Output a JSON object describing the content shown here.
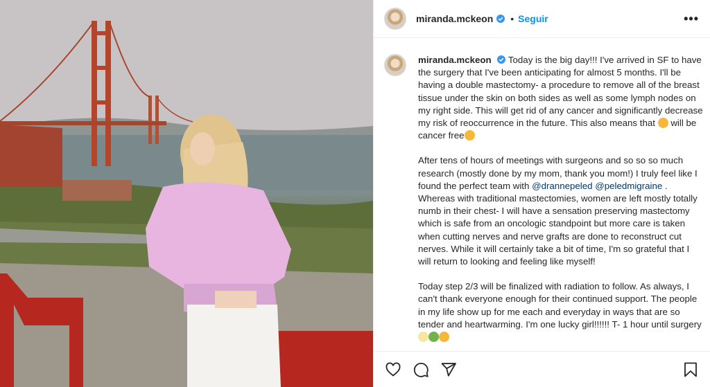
{
  "post": {
    "username": "miranda.mckeon",
    "follow_label": "Seguir",
    "dot": "•",
    "more": "•••",
    "caption": {
      "p1_a": "Today is the big day!!! I've arrived in SF to have the surgery that I've been anticipating for almost 5 months. I'll be having a double mastectomy- a procedure to remove all of the breast tissue under the skin on both sides as well as some lymph nodes on my right side. This will get rid of any cancer and significantly decrease my risk of reoccurrence in the future. This also means that ",
      "p1_b": " will be cancer free",
      "p2_a": "After tens of hours of meetings with surgeons and so so so much research (mostly done by my mom, thank you mom!) I truly feel like I found the perfect team with ",
      "mention1": "@drannepeled",
      "mention2": "@peledmigraine",
      "p2_b": " . Whereas with traditional mastectomies, women are left mostly totally numb in their chest- I will have a sensation preserving mastectomy which is safe from an oncologic standpoint but more care is taken when cutting nerves and nerve grafts are done to reconstruct cut nerves. While it will certainly take a bit of time, I'm so grateful that I will return to looking and feeling like myself!",
      "p3_a": "Today step 2/3 will be finalized with radiation to follow. As always, I can't thank everyone enough for their continued support. The people in my life show up for me each and everyday in ways that are so tender and heartwarming. I'm one lucky girl!!!!!! T- 1 hour until surgery"
    },
    "icons": {
      "verified": "verified-badge-icon",
      "like": "heart-icon",
      "comment": "comment-icon",
      "share": "send-icon",
      "save": "bookmark-icon"
    },
    "colors": {
      "link": "#0095f6",
      "mention": "#00376b",
      "text": "#262626",
      "verified": "#3897f0"
    }
  }
}
